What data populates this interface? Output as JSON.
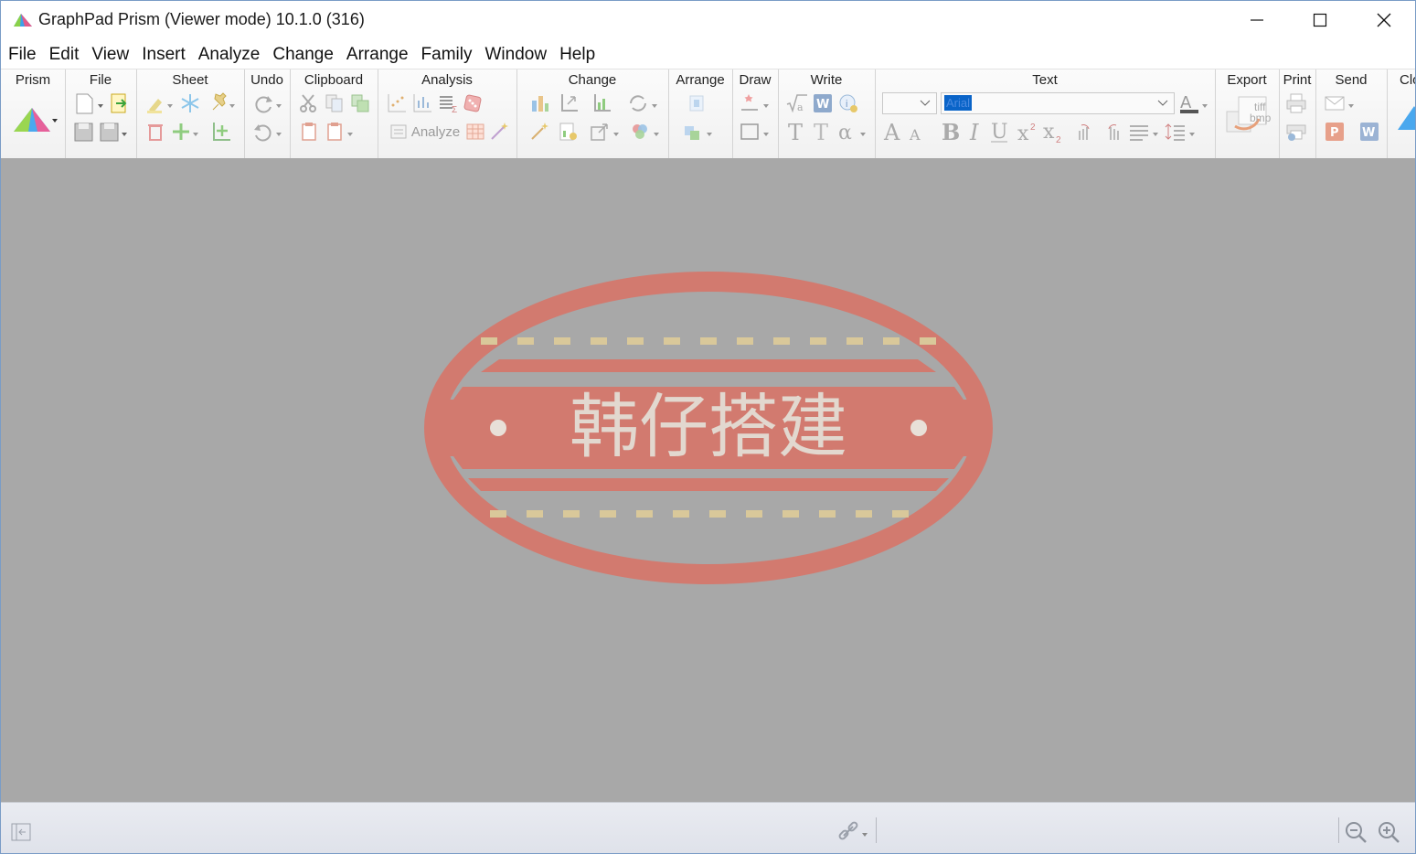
{
  "window": {
    "title": "GraphPad Prism (Viewer mode) 10.1.0 (316)"
  },
  "menu": [
    "File",
    "Edit",
    "View",
    "Insert",
    "Analyze",
    "Change",
    "Arrange",
    "Family",
    "Window",
    "Help"
  ],
  "ribbon": {
    "groups": [
      "Prism",
      "File",
      "Sheet",
      "Undo",
      "Clipboard",
      "Analysis",
      "Change",
      "Arrange",
      "Draw",
      "Write",
      "Text",
      "Export",
      "Print",
      "Send",
      "Clo"
    ],
    "analyze_label": "Analyze",
    "font_name": "Arial",
    "export_tiff": "tiff",
    "export_bmp": "bmp"
  },
  "watermark": {
    "text": "韩仔搭建"
  },
  "colors": {
    "canvas_bg": "#a8a8a8",
    "watermark_red": "#d27a6f",
    "dash_yellow": "#d9c89a",
    "select_blue": "#0a64c8"
  }
}
